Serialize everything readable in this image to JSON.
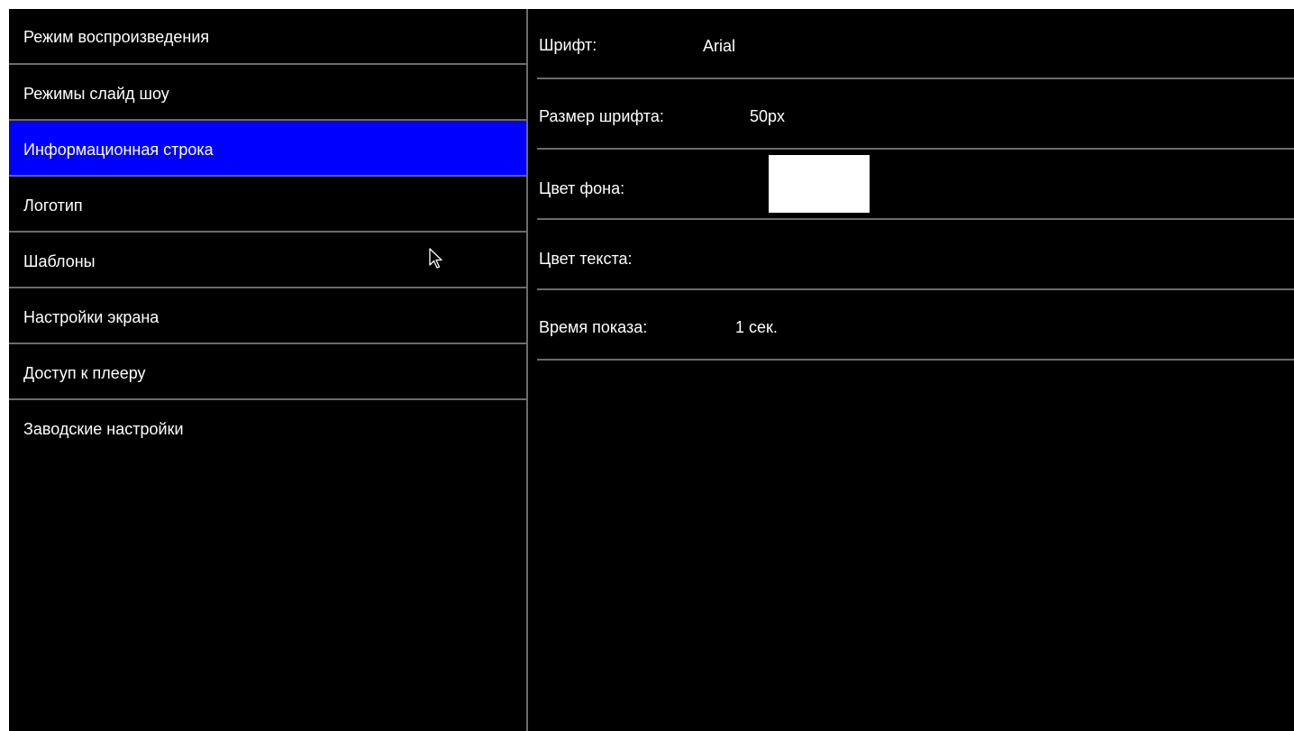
{
  "sidebar": {
    "items": [
      {
        "label": "Режим воспроизведения"
      },
      {
        "label": "Режимы слайд шоу"
      },
      {
        "label": "Информационная строка"
      },
      {
        "label": "Логотип"
      },
      {
        "label": "Шаблоны"
      },
      {
        "label": "Настройки экрана"
      },
      {
        "label": "Доступ к плееру"
      },
      {
        "label": "Заводские настройки"
      }
    ],
    "selected_index": 2,
    "selected_color": "#0000ff"
  },
  "settings": {
    "font": {
      "label": "Шрифт:",
      "value": "Arial"
    },
    "font_size": {
      "label": "Размер шрифта:",
      "value": "50px"
    },
    "background_color": {
      "label": "Цвет фона:",
      "color": "#ffffff"
    },
    "text_color": {
      "label": "Цвет текста:",
      "color": "#000000"
    },
    "display_time": {
      "label": "Время показа:",
      "value": "1 сек."
    }
  },
  "cursor": {
    "icon": "arrow-pointer-icon"
  }
}
